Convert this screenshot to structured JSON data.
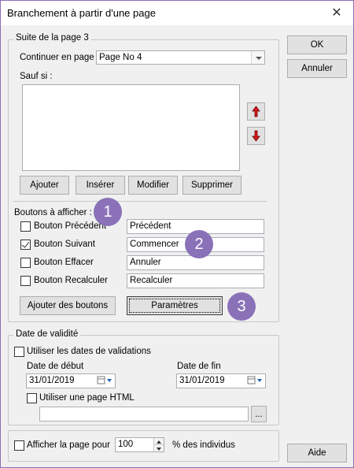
{
  "window": {
    "title": "Branchement à partir d'une page"
  },
  "right_buttons": {
    "ok": "OK",
    "cancel": "Annuler",
    "help": "Aide"
  },
  "page_group": {
    "legend": "Suite de la page 3",
    "continue_label": "Continuer en page",
    "continue_value": "Page No 4",
    "except_label": "Sauf si :",
    "condition_buttons": [
      "Ajouter",
      "Insérer",
      "Modifier",
      "Supprimer"
    ],
    "buttons_section_label": "Boutons à afficher :",
    "nav_buttons": [
      {
        "label": "Bouton Précédent",
        "checked": false,
        "value": "Précédent"
      },
      {
        "label": "Bouton Suivant",
        "checked": true,
        "value": "Commencer"
      },
      {
        "label": "Bouton Effacer",
        "checked": false,
        "value": "Annuler"
      },
      {
        "label": "Bouton Recalculer",
        "checked": false,
        "value": "Recalculer"
      }
    ],
    "add_buttons_label": "Ajouter des boutons",
    "parameters_label": "Paramètres"
  },
  "validity_group": {
    "legend": "Date de validité",
    "use_dates_label": "Utiliser les dates de validations",
    "start_label": "Date de début",
    "start_value": "31/01/2019",
    "end_label": "Date de fin",
    "end_value": "31/01/2019",
    "html_page_label": "Utiliser une page HTML",
    "html_page_value": "",
    "browse_label": "..."
  },
  "display_group": {
    "label": "Afficher la page pour",
    "value": "100",
    "suffix": "% des individus"
  },
  "badges": [
    "1",
    "2",
    "3"
  ]
}
